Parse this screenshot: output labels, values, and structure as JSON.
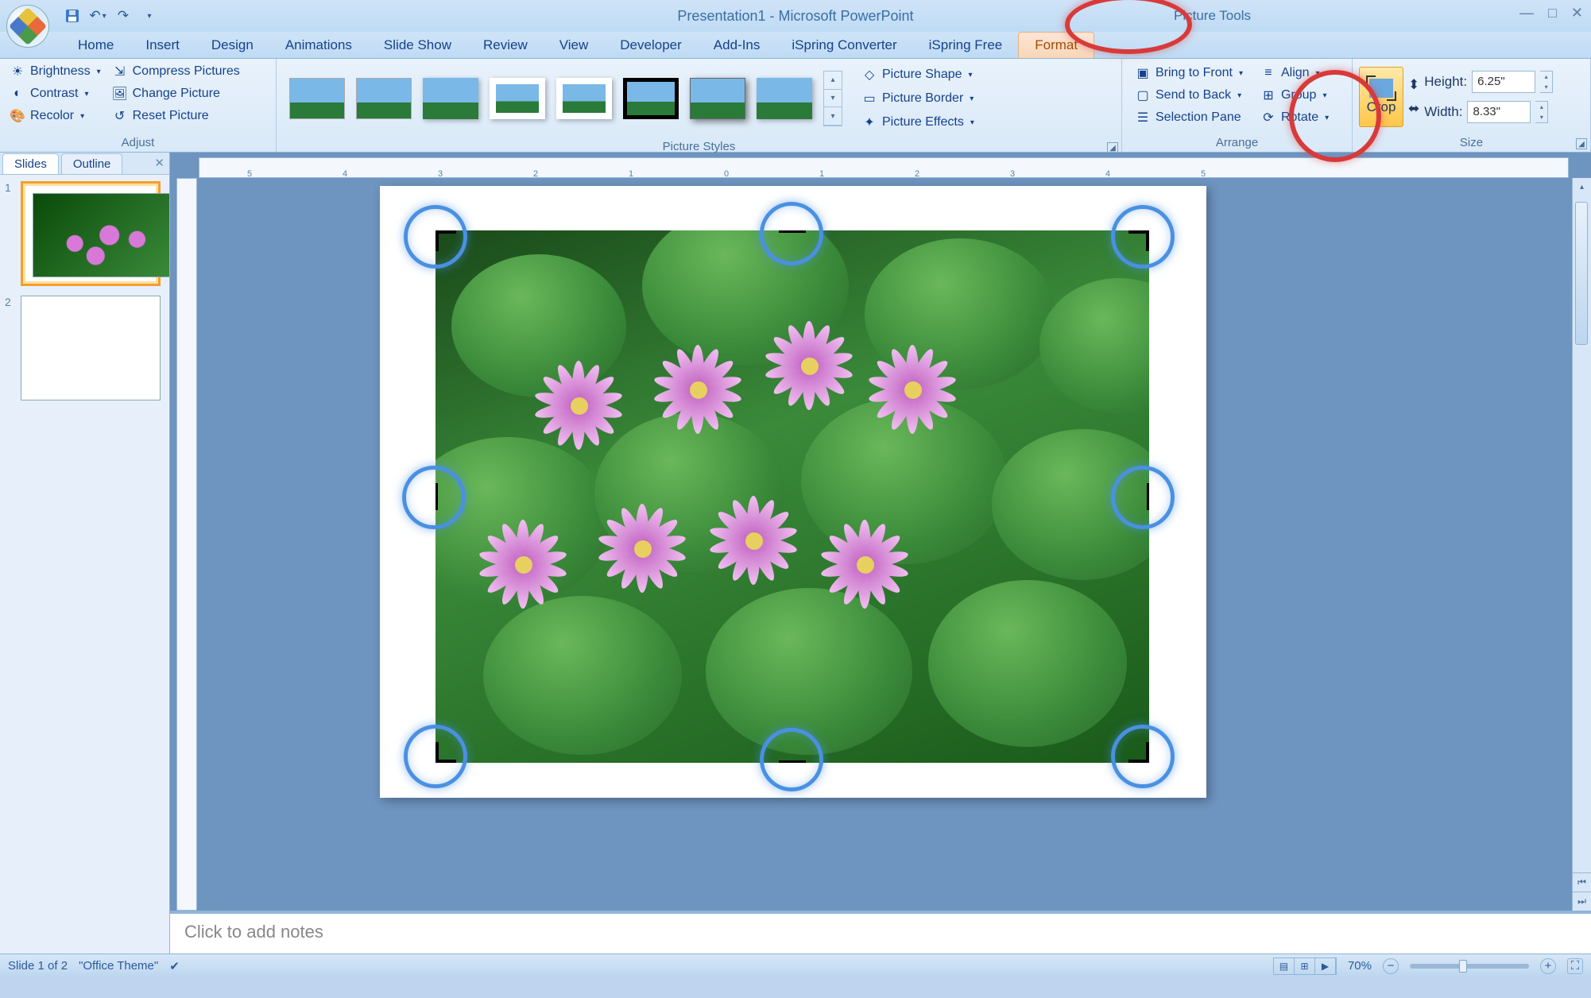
{
  "title": "Presentation1 - Microsoft PowerPoint",
  "contextual_tab": "Picture Tools",
  "tabs": [
    "Home",
    "Insert",
    "Design",
    "Animations",
    "Slide Show",
    "Review",
    "View",
    "Developer",
    "Add-Ins",
    "iSpring Converter",
    "iSpring Free",
    "Format"
  ],
  "active_tab": "Format",
  "ribbon": {
    "adjust": {
      "label": "Adjust",
      "brightness": "Brightness",
      "contrast": "Contrast",
      "recolor": "Recolor",
      "compress": "Compress Pictures",
      "change": "Change Picture",
      "reset": "Reset Picture"
    },
    "styles": {
      "label": "Picture Styles",
      "shape": "Picture Shape",
      "border": "Picture Border",
      "effects": "Picture Effects"
    },
    "arrange": {
      "label": "Arrange",
      "front": "Bring to Front",
      "back": "Send to Back",
      "pane": "Selection Pane",
      "align": "Align",
      "group": "Group",
      "rotate": "Rotate"
    },
    "size": {
      "label": "Size",
      "crop": "Crop",
      "height_label": "Height:",
      "height_value": "6.25\"",
      "width_label": "Width:",
      "width_value": "8.33\""
    }
  },
  "slidepane": {
    "tabs": [
      "Slides",
      "Outline"
    ],
    "slides": [
      1,
      2
    ]
  },
  "notes_placeholder": "Click to add notes",
  "status": {
    "slide": "Slide 1 of 2",
    "theme": "\"Office Theme\"",
    "zoom": "70%"
  }
}
